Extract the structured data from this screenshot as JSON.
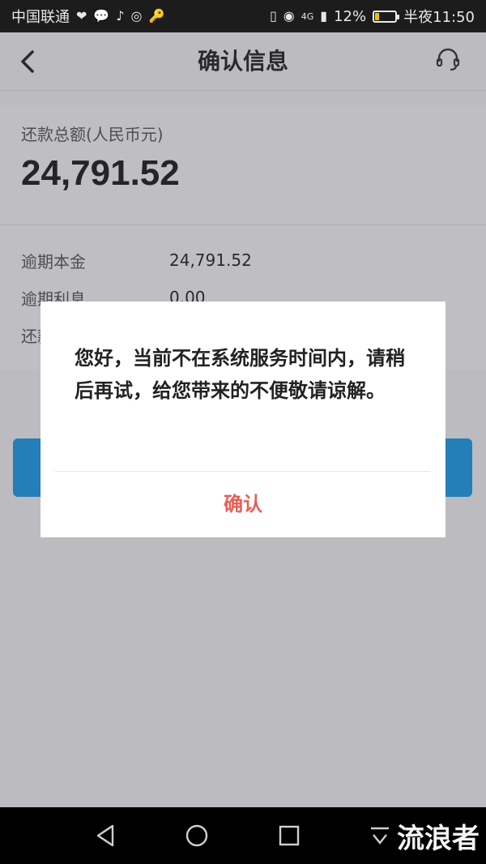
{
  "statusbar": {
    "carrier": "中国联通",
    "network": "4G",
    "battery_text": "12%",
    "battery_level": 0.12,
    "time": "半夜11:50"
  },
  "navbar": {
    "title": "确认信息",
    "back_icon": "chevron-left-icon",
    "service_icon": "headset-icon"
  },
  "summary": {
    "label": "还款总额(人民币元)",
    "amount": "24,791.52"
  },
  "details": {
    "rows": [
      {
        "label": "逾期本金",
        "value": "24,791.52"
      },
      {
        "label": "逾期利息",
        "value": "0.00"
      },
      {
        "label": "还款",
        "value": ""
      }
    ]
  },
  "dialog": {
    "message": "您好，当前不在系统服务时间内，请稍后再试，给您带来的不便敬请谅解。",
    "confirm_label": "确认"
  },
  "watermark": "流浪者",
  "colors": {
    "accent": "#1a9be6",
    "confirm": "#e55f59"
  }
}
